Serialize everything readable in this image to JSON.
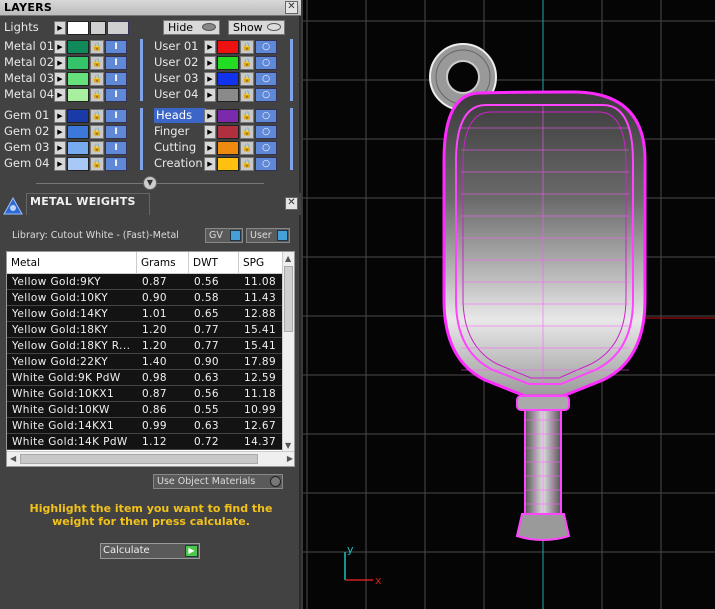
{
  "layers": {
    "title": "LAYERS",
    "lights_label": "Lights",
    "hide_label": "Hide",
    "show_label": "Show",
    "metal": [
      {
        "name": "Metal 01",
        "color": "#108a5a"
      },
      {
        "name": "Metal 02",
        "color": "#36c46a"
      },
      {
        "name": "Metal 03",
        "color": "#66e07a"
      },
      {
        "name": "Metal 04",
        "color": "#a8f0a0"
      }
    ],
    "user": [
      {
        "name": "User 01",
        "color": "#ee1111"
      },
      {
        "name": "User 02",
        "color": "#22dd22"
      },
      {
        "name": "User 03",
        "color": "#1133ee"
      },
      {
        "name": "User 04",
        "color": "#8a8a8a"
      }
    ],
    "gem": [
      {
        "name": "Gem 01",
        "color": "#1a3aa8"
      },
      {
        "name": "Gem 02",
        "color": "#3c78d8"
      },
      {
        "name": "Gem 03",
        "color": "#78aaf0"
      },
      {
        "name": "Gem 04",
        "color": "#a8c8f8"
      }
    ],
    "special": [
      {
        "name": "Heads",
        "color": "#7a2aaa"
      },
      {
        "name": "Finger",
        "color": "#b03040"
      },
      {
        "name": "Cutting",
        "color": "#ee8a10"
      },
      {
        "name": "Creation",
        "color": "#ffc010"
      }
    ]
  },
  "metal_weights": {
    "title": "METAL WEIGHTS",
    "library": "Library: Cutout White - (Fast)-Metal",
    "gv_label": "GV",
    "user_label": "User",
    "columns": [
      "Metal",
      "Grams",
      "DWT",
      "SPG"
    ],
    "rows": [
      [
        "Yellow Gold:9KY",
        "0.87",
        "0.56",
        "11.08"
      ],
      [
        "Yellow Gold:10KY",
        "0.90",
        "0.58",
        "11.43"
      ],
      [
        "Yellow Gold:14KY",
        "1.01",
        "0.65",
        "12.88"
      ],
      [
        "Yellow Gold:18KY",
        "1.20",
        "0.77",
        "15.41"
      ],
      [
        "Yellow Gold:18KY R...",
        "1.20",
        "0.77",
        "15.41"
      ],
      [
        "Yellow Gold:22KY",
        "1.40",
        "0.90",
        "17.89"
      ],
      [
        "White Gold:9K PdW",
        "0.98",
        "0.63",
        "12.59"
      ],
      [
        "White Gold:10KX1",
        "0.87",
        "0.56",
        "11.18"
      ],
      [
        "White Gold:10KW",
        "0.86",
        "0.55",
        "10.99"
      ],
      [
        "White Gold:14KX1",
        "0.99",
        "0.63",
        "12.67"
      ],
      [
        "White Gold:14K PdW",
        "1.12",
        "0.72",
        "14.37"
      ]
    ],
    "use_object_materials": "Use Object Materials",
    "hint": "Highlight the item you want to find the weight for then press calculate.",
    "calculate_label": "Calculate"
  },
  "viewport": {
    "axis_y_label": "y",
    "axis_x_label": "x"
  }
}
